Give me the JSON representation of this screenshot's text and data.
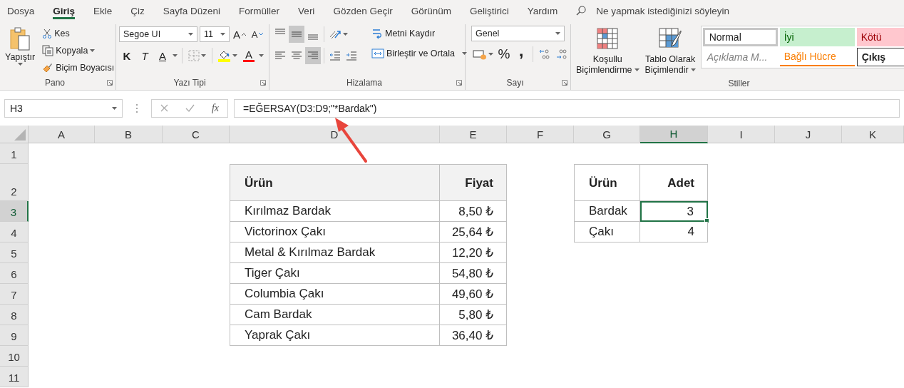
{
  "tabs": [
    {
      "label": "Dosya",
      "selected": false
    },
    {
      "label": "Giriş",
      "selected": true
    },
    {
      "label": "Ekle",
      "selected": false
    },
    {
      "label": "Çiz",
      "selected": false
    },
    {
      "label": "Sayfa Düzeni",
      "selected": false
    },
    {
      "label": "Formüller",
      "selected": false
    },
    {
      "label": "Veri",
      "selected": false
    },
    {
      "label": "Gözden Geçir",
      "selected": false
    },
    {
      "label": "Görünüm",
      "selected": false
    },
    {
      "label": "Geliştirici",
      "selected": false
    },
    {
      "label": "Yardım",
      "selected": false
    }
  ],
  "tell_me": {
    "placeholder": "Ne yapmak istediğinizi söyleyin"
  },
  "clipboard": {
    "label": "Pano",
    "paste": "Yapıştır",
    "cut": "Kes",
    "copy": "Kopyala",
    "format_painter": "Biçim Boyacısı"
  },
  "font": {
    "label": "Yazı Tipi",
    "family": "Segoe UI",
    "size": "11",
    "grow": "A",
    "shrink": "A",
    "bold": "K",
    "italic": "T",
    "underline": "A",
    "font_color": "A"
  },
  "alignment": {
    "label": "Hizalama",
    "vertical": [
      {
        "kind": "top",
        "selected": false
      },
      {
        "kind": "middle",
        "selected": true
      },
      {
        "kind": "bottom",
        "selected": false
      }
    ],
    "horizontal": [
      {
        "kind": "left",
        "selected": false
      },
      {
        "kind": "center",
        "selected": false
      },
      {
        "kind": "right",
        "selected": true
      }
    ],
    "wrap_text": "Metni Kaydır",
    "merge_center": "Birleştir ve Ortala"
  },
  "number": {
    "label": "Sayı",
    "format": "Genel",
    "percent": "%",
    "comma": ","
  },
  "styles": {
    "label": "Stiller",
    "conditional": [
      "Koşullu",
      "Biçimlendirme"
    ],
    "format_table": [
      "Tablo Olarak",
      "Biçimlendir"
    ],
    "gallery": [
      {
        "label": "Normal",
        "kind": "normal",
        "selected": true
      },
      {
        "label": "İyi",
        "kind": "good",
        "selected": false
      },
      {
        "label": "Kötü",
        "kind": "bad",
        "selected": false
      },
      {
        "label": "Açıklama M...",
        "kind": "explanatory",
        "selected": false
      },
      {
        "label": "Bağlı Hücre",
        "kind": "linked",
        "selected": false
      },
      {
        "label": "Çıkış",
        "kind": "output",
        "selected": false
      }
    ]
  },
  "formula_bar": {
    "name_box": "H3",
    "function_label": "fx",
    "formula": "=EĞERSAY(D3:D9;\"*Bardak\")"
  },
  "sheet": {
    "columns": [
      {
        "label": "A",
        "selected": false
      },
      {
        "label": "B",
        "selected": false
      },
      {
        "label": "C",
        "selected": false
      },
      {
        "label": "D",
        "selected": false
      },
      {
        "label": "E",
        "selected": false
      },
      {
        "label": "F",
        "selected": false
      },
      {
        "label": "G",
        "selected": false
      },
      {
        "label": "H",
        "selected": true
      },
      {
        "label": "I",
        "selected": false
      },
      {
        "label": "J",
        "selected": false
      },
      {
        "label": "K",
        "selected": false
      }
    ],
    "rows": [
      {
        "label": "1",
        "selected": false
      },
      {
        "label": "2",
        "selected": false
      },
      {
        "label": "3",
        "selected": true
      },
      {
        "label": "4",
        "selected": false
      },
      {
        "label": "5",
        "selected": false
      },
      {
        "label": "6",
        "selected": false
      },
      {
        "label": "7",
        "selected": false
      },
      {
        "label": "8",
        "selected": false
      },
      {
        "label": "9",
        "selected": false
      },
      {
        "label": "10",
        "selected": false
      },
      {
        "label": "11",
        "selected": false
      }
    ]
  },
  "products_table": {
    "columns": [
      "Ürün",
      "Fiyat"
    ],
    "rows": [
      [
        "Kırılmaz Bardak",
        "8,50 ₺"
      ],
      [
        "Victorinox Çakı",
        "25,64 ₺"
      ],
      [
        "Metal & Kırılmaz Bardak",
        "12,20 ₺"
      ],
      [
        "Tiger Çakı",
        "54,80 ₺"
      ],
      [
        "Columbia Çakı",
        "49,60 ₺"
      ],
      [
        "Cam Bardak",
        "5,80 ₺"
      ],
      [
        "Yaprak Çakı",
        "36,40 ₺"
      ]
    ]
  },
  "count_table": {
    "columns": [
      "Ürün",
      "Adet"
    ],
    "rows": [
      {
        "product": "Bardak",
        "count": "3",
        "selected": true
      },
      {
        "product": "Çakı",
        "count": "4",
        "selected": false
      }
    ]
  }
}
